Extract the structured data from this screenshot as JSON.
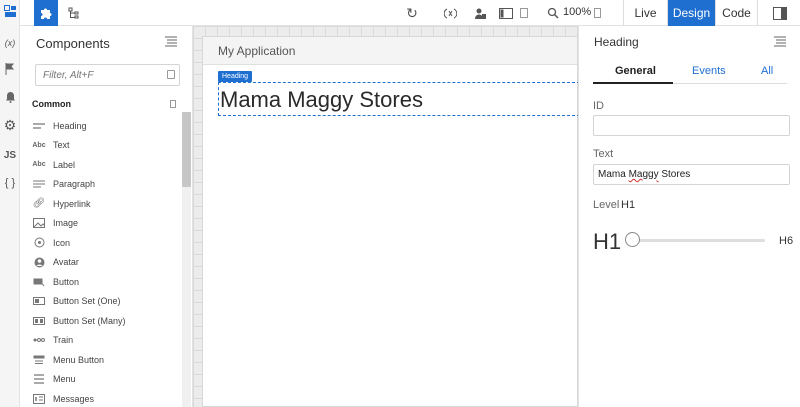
{
  "toolbar": {
    "zoom": "100%",
    "modes": [
      {
        "label": "Live",
        "active": false
      },
      {
        "label": "Design",
        "active": true
      },
      {
        "label": "Code",
        "active": false
      }
    ]
  },
  "components": {
    "title": "Components",
    "filter_placeholder": "Filter, Alt+F",
    "section": "Common",
    "items": [
      {
        "label": "Heading",
        "icon": "heading-icon"
      },
      {
        "label": "Text",
        "icon": "text-icon"
      },
      {
        "label": "Label",
        "icon": "label-icon"
      },
      {
        "label": "Paragraph",
        "icon": "paragraph-icon"
      },
      {
        "label": "Hyperlink",
        "icon": "link-icon"
      },
      {
        "label": "Image",
        "icon": "image-icon"
      },
      {
        "label": "Icon",
        "icon": "icon-icon"
      },
      {
        "label": "Avatar",
        "icon": "avatar-icon"
      },
      {
        "label": "Button",
        "icon": "button-icon"
      },
      {
        "label": "Button Set (One)",
        "icon": "button-set-one-icon"
      },
      {
        "label": "Button Set (Many)",
        "icon": "button-set-many-icon"
      },
      {
        "label": "Train",
        "icon": "train-icon"
      },
      {
        "label": "Menu Button",
        "icon": "menu-button-icon"
      },
      {
        "label": "Menu",
        "icon": "menu-icon"
      },
      {
        "label": "Messages",
        "icon": "messages-icon"
      }
    ]
  },
  "canvas": {
    "page_title": "My Application",
    "selection_tag": "Heading",
    "heading_text": "Mama Maggy Stores"
  },
  "properties": {
    "title": "Heading",
    "tabs": [
      "General",
      "Events",
      "All"
    ],
    "id_label": "ID",
    "id_value": "",
    "text_label": "Text",
    "text_value_pre": "Mama ",
    "text_value_misspelled": "Maggy",
    "text_value_post": " Stores",
    "level_label": "Level",
    "level_value": "H1",
    "slider_min_label": "H1",
    "slider_max_label": "H6",
    "slider_fraction": 0.0
  },
  "colors": {
    "accent": "#1f6fd0"
  }
}
